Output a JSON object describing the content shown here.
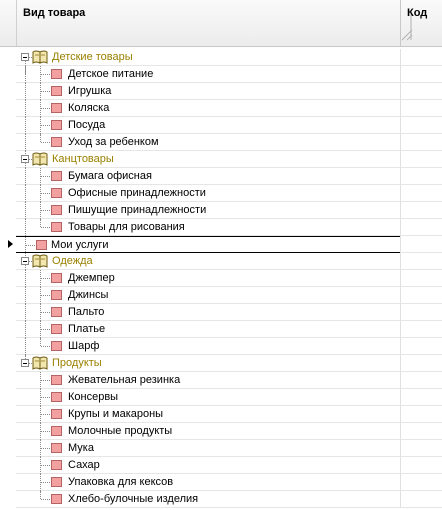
{
  "columns": {
    "name": "Вид товара",
    "code": "Код"
  },
  "rows": [
    {
      "kind": "group",
      "label": "Детские товары"
    },
    {
      "kind": "leaf",
      "label": "Детское питание"
    },
    {
      "kind": "leaf",
      "label": "Игрушка"
    },
    {
      "kind": "leaf",
      "label": "Коляска"
    },
    {
      "kind": "leaf",
      "label": "Посуда"
    },
    {
      "kind": "leaf",
      "label": "Уход за ребенком"
    },
    {
      "kind": "group",
      "label": "Канцтовары"
    },
    {
      "kind": "leaf",
      "label": "Бумага офисная"
    },
    {
      "kind": "leaf",
      "label": "Офисные принадлежности"
    },
    {
      "kind": "leaf",
      "label": "Пишущие принадлежности"
    },
    {
      "kind": "leaf",
      "label": "Товары для рисования"
    },
    {
      "kind": "item",
      "label": "Мои услуги",
      "selected": true
    },
    {
      "kind": "group",
      "label": "Одежда"
    },
    {
      "kind": "leaf",
      "label": "Джемпер"
    },
    {
      "kind": "leaf",
      "label": "Джинсы"
    },
    {
      "kind": "leaf",
      "label": "Пальто"
    },
    {
      "kind": "leaf",
      "label": "Платье"
    },
    {
      "kind": "leaf",
      "label": "Шарф"
    },
    {
      "kind": "group",
      "label": "Продукты"
    },
    {
      "kind": "leaf",
      "label": "Жевательная резинка"
    },
    {
      "kind": "leaf",
      "label": "Консервы"
    },
    {
      "kind": "leaf",
      "label": "Крупы и макароны"
    },
    {
      "kind": "leaf",
      "label": "Молочные продукты"
    },
    {
      "kind": "leaf",
      "label": "Мука"
    },
    {
      "kind": "leaf",
      "label": "Сахар"
    },
    {
      "kind": "leaf",
      "label": "Упаковка для кексов"
    },
    {
      "kind": "leaf",
      "label": "Хлебо-булочные изделия"
    }
  ],
  "colors": {
    "group_text": "#9a8000",
    "leaf_icon": "#f2a0a0"
  },
  "icons": {
    "group": "book-icon",
    "leaf": "leaf-icon",
    "current_row": "pointer-icon",
    "expander": "collapse-icon"
  }
}
